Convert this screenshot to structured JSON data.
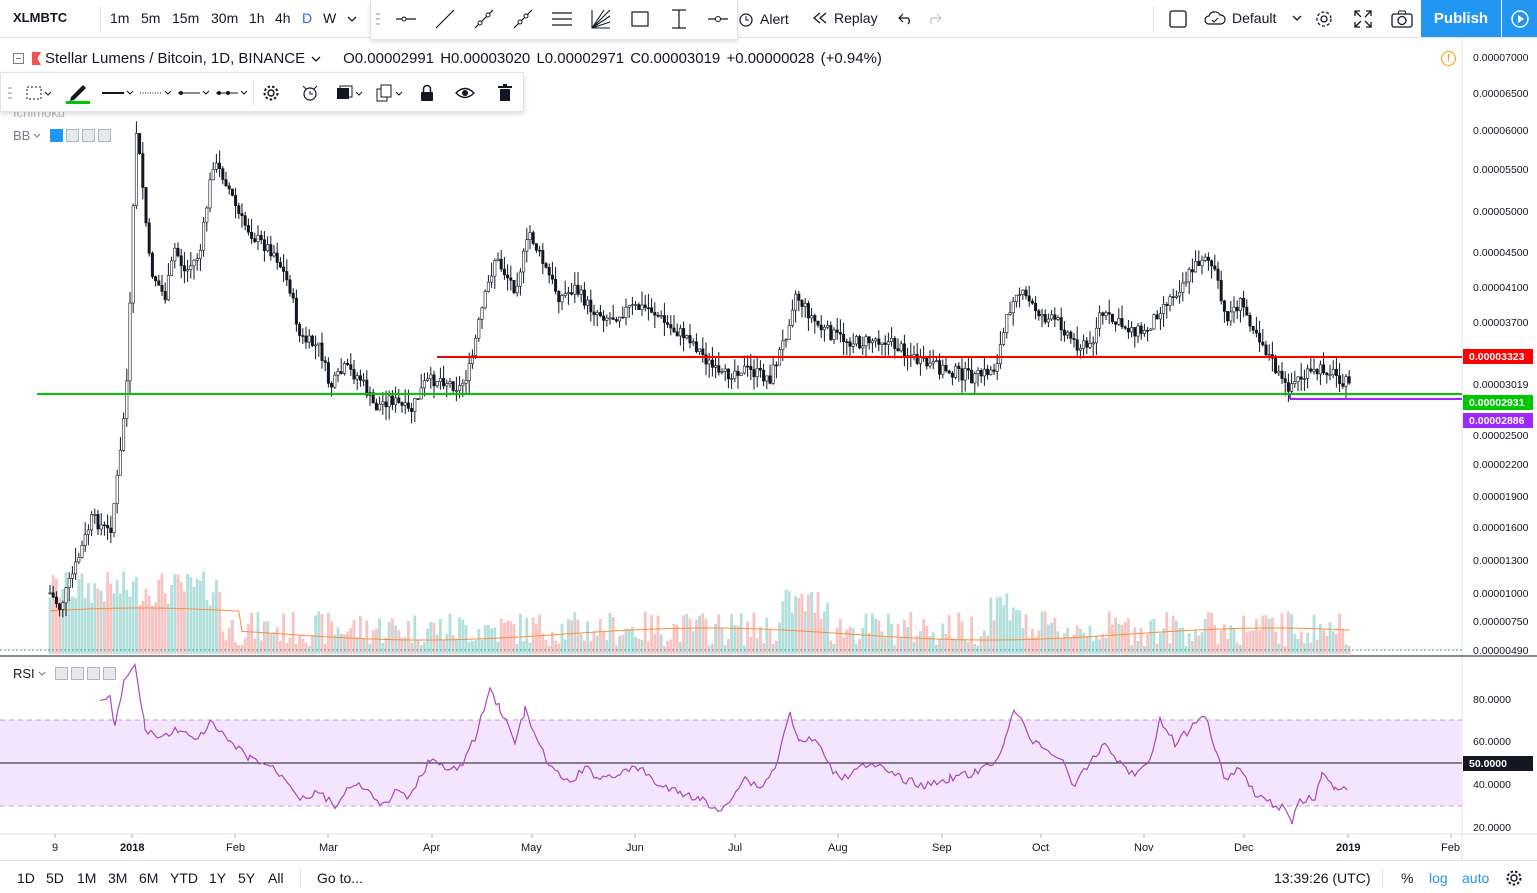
{
  "header": {
    "symbol": "XLMBTC",
    "timeframes": [
      "1m",
      "5m",
      "15m",
      "30m",
      "1h",
      "4h",
      "D",
      "W"
    ],
    "active_timeframe": "D",
    "alert_label": "Alert",
    "replay_label": "Replay",
    "layout_label": "Default",
    "publish_label": "Publish"
  },
  "legend": {
    "title": "Stellar Lumens / Bitcoin, 1D, BINANCE",
    "ohlc": "O0.00002991 H0.00003020 L0.00002971 C0.00003019 +0.00000028 (+0.94%)",
    "indicator_hidden": "Ichimoku",
    "bb_label": "BB",
    "rsi_label": "RSI"
  },
  "price_scale": {
    "labels": [
      "0.00007000",
      "0.00006500",
      "0.00006000",
      "0.00005500",
      "0.00005000",
      "0.00004500",
      "0.00004100",
      "0.00003700",
      "0.00003019",
      "0.00002500",
      "0.00002200",
      "0.00001900",
      "0.00001600",
      "0.00001300",
      "0.00001000",
      "0.00000750",
      "0.00000490"
    ],
    "badges": [
      {
        "text": "0.00003323",
        "color": "#ff0000"
      },
      {
        "text": "0.00002931",
        "color": "#00c800"
      },
      {
        "text": "0.00002886",
        "color": "#9c27ff"
      }
    ]
  },
  "rsi_scale": {
    "labels": [
      "80.0000",
      "60.0000",
      "40.0000",
      "20.0000"
    ],
    "badge": "50.0000"
  },
  "time_axis": [
    "9",
    "2018",
    "Feb",
    "Mar",
    "Apr",
    "May",
    "Jun",
    "Jul",
    "Aug",
    "Sep",
    "Oct",
    "Nov",
    "Dec",
    "2019",
    "Feb"
  ],
  "bottom": {
    "ranges": [
      "1D",
      "5D",
      "1M",
      "3M",
      "6M",
      "YTD",
      "1Y",
      "5Y",
      "All"
    ],
    "goto_label": "Go to...",
    "clock": "13:39:26 (UTC)",
    "percent_label": "%",
    "log_label": "log",
    "auto_label": "auto"
  },
  "colors": {
    "up": "#26a69a",
    "down": "#ef5350",
    "resistance": "#ff0000",
    "support": "#00c800",
    "low_line": "#9c27ff",
    "rsi": "#ab47bc",
    "accent": "#2196f3"
  }
}
